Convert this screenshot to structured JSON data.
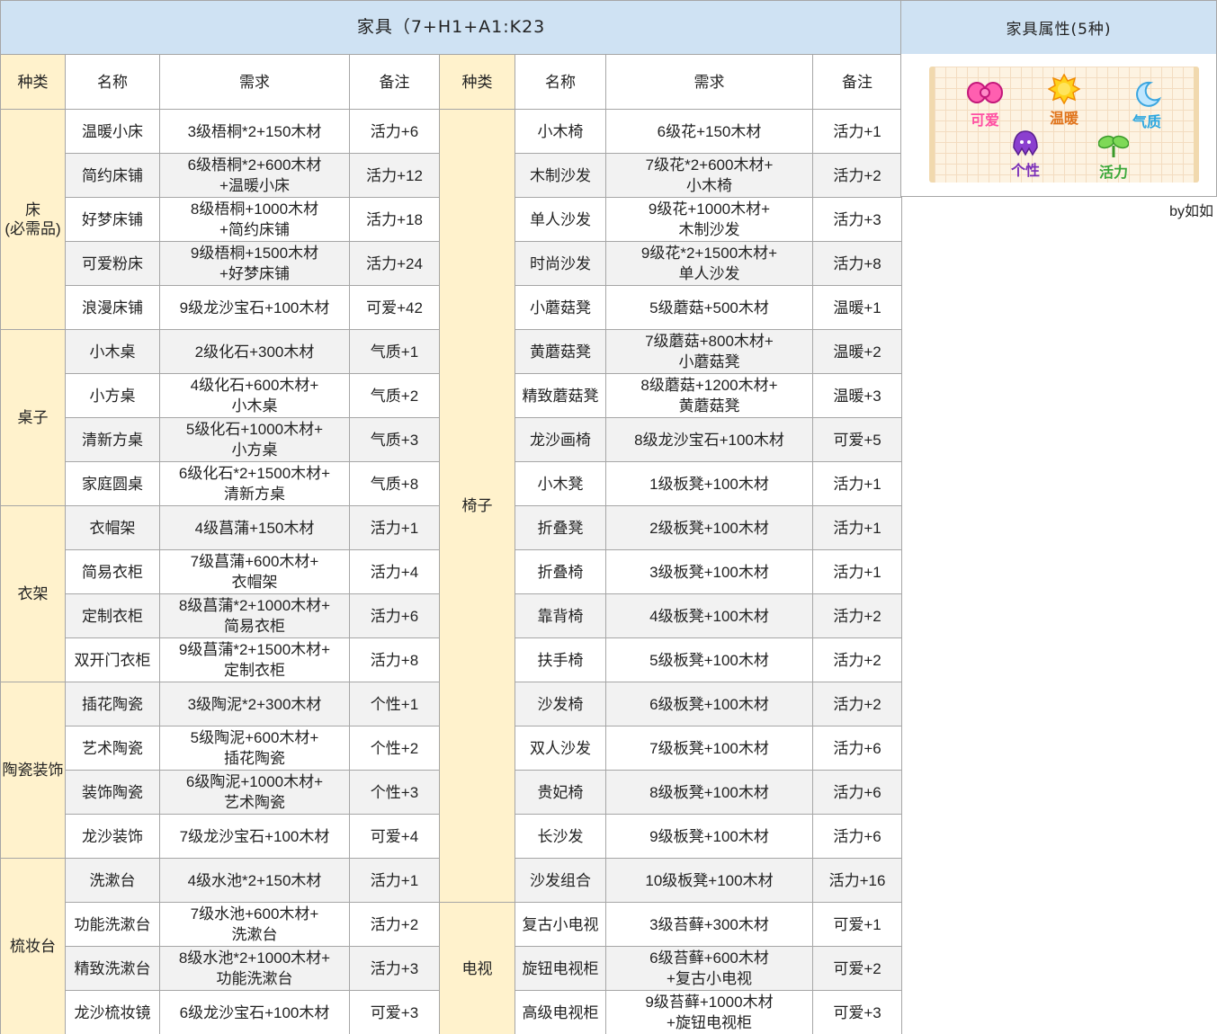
{
  "title": "家具（7+H1+A1:K23",
  "headers": {
    "left": [
      "种类",
      "名称",
      "需求",
      "备注"
    ],
    "right": [
      "种类",
      "名称",
      "需求",
      "备注"
    ]
  },
  "categories": {
    "bed": "床\n(必需品)",
    "table": "桌子",
    "hanger": "衣架",
    "ceramic": "陶瓷装饰",
    "dresser": "梳妆台",
    "chair": "椅子",
    "tv": "电视"
  },
  "rows": [
    {
      "l": [
        "温暖小床",
        "3级梧桐*2+150木材",
        "活力+6"
      ],
      "r": [
        "小木椅",
        "6级花+150木材",
        "活力+1"
      ]
    },
    {
      "l": [
        "简约床铺",
        "6级梧桐*2+600木材\n+温暖小床",
        "活力+12"
      ],
      "r": [
        "木制沙发",
        "7级花*2+600木材+\n小木椅",
        "活力+2"
      ]
    },
    {
      "l": [
        "好梦床铺",
        "8级梧桐+1000木材\n+简约床铺",
        "活力+18"
      ],
      "r": [
        "单人沙发",
        "9级花+1000木材+\n木制沙发",
        "活力+3"
      ]
    },
    {
      "l": [
        "可爱粉床",
        "9级梧桐+1500木材\n+好梦床铺",
        "活力+24"
      ],
      "r": [
        "时尚沙发",
        "9级花*2+1500木材+\n单人沙发",
        "活力+8"
      ]
    },
    {
      "l": [
        "浪漫床铺",
        "9级龙沙宝石+100木材",
        "可爱+42"
      ],
      "r": [
        "小蘑菇凳",
        "5级蘑菇+500木材",
        "温暖+1"
      ]
    },
    {
      "l": [
        "小木桌",
        "2级化石+300木材",
        "气质+1"
      ],
      "r": [
        "黄蘑菇凳",
        "7级蘑菇+800木材+\n小蘑菇凳",
        "温暖+2"
      ]
    },
    {
      "l": [
        "小方桌",
        "4级化石+600木材+\n小木桌",
        "气质+2"
      ],
      "r": [
        "精致蘑菇凳",
        "8级蘑菇+1200木材+\n黄蘑菇凳",
        "温暖+3"
      ]
    },
    {
      "l": [
        "清新方桌",
        "5级化石+1000木材+\n小方桌",
        "气质+3"
      ],
      "r": [
        "龙沙画椅",
        "8级龙沙宝石+100木材",
        "可爱+5"
      ]
    },
    {
      "l": [
        "家庭圆桌",
        "6级化石*2+1500木材+\n清新方桌",
        "气质+8"
      ],
      "r": [
        "小木凳",
        "1级板凳+100木材",
        "活力+1"
      ]
    },
    {
      "l": [
        "衣帽架",
        "4级菖蒲+150木材",
        "活力+1"
      ],
      "r": [
        "折叠凳",
        "2级板凳+100木材",
        "活力+1"
      ]
    },
    {
      "l": [
        "简易衣柜",
        "7级菖蒲+600木材+\n衣帽架",
        "活力+4"
      ],
      "r": [
        "折叠椅",
        "3级板凳+100木材",
        "活力+1"
      ]
    },
    {
      "l": [
        "定制衣柜",
        "8级菖蒲*2+1000木材+\n简易衣柜",
        "活力+6"
      ],
      "r": [
        "靠背椅",
        "4级板凳+100木材",
        "活力+2"
      ]
    },
    {
      "l": [
        "双开门衣柜",
        "9级菖蒲*2+1500木材+\n定制衣柜",
        "活力+8"
      ],
      "r": [
        "扶手椅",
        "5级板凳+100木材",
        "活力+2"
      ]
    },
    {
      "l": [
        "插花陶瓷",
        "3级陶泥*2+300木材",
        "个性+1"
      ],
      "r": [
        "沙发椅",
        "6级板凳+100木材",
        "活力+2"
      ]
    },
    {
      "l": [
        "艺术陶瓷",
        "5级陶泥+600木材+\n插花陶瓷",
        "个性+2"
      ],
      "r": [
        "双人沙发",
        "7级板凳+100木材",
        "活力+6"
      ]
    },
    {
      "l": [
        "装饰陶瓷",
        "6级陶泥+1000木材+\n艺术陶瓷",
        "个性+3"
      ],
      "r": [
        "贵妃椅",
        "8级板凳+100木材",
        "活力+6"
      ]
    },
    {
      "l": [
        "龙沙装饰",
        "7级龙沙宝石+100木材",
        "可爱+4"
      ],
      "r": [
        "长沙发",
        "9级板凳+100木材",
        "活力+6"
      ]
    },
    {
      "l": [
        "洗漱台",
        "4级水池*2+150木材",
        "活力+1"
      ],
      "r": [
        "沙发组合",
        "10级板凳+100木材",
        "活力+16"
      ]
    },
    {
      "l": [
        "功能洗漱台",
        "7级水池+600木材+\n洗漱台",
        "活力+2"
      ],
      "r": [
        "复古小电视",
        "3级苔藓+300木材",
        "可爱+1"
      ]
    },
    {
      "l": [
        "精致洗漱台",
        "8级水池*2+1000木材+\n功能洗漱台",
        "活力+3"
      ],
      "r": [
        "旋钮电视柜",
        "6级苔藓+600木材\n+复古小电视",
        "可爱+2"
      ]
    },
    {
      "l": [
        "龙沙梳妆镜",
        "6级龙沙宝石+100木材",
        "可爱+3"
      ],
      "r": [
        "高级电视柜",
        "9级苔藓+1000木材\n+旋钮电视柜",
        "可爱+3"
      ]
    }
  ],
  "attributes": {
    "title": "家具属性(5种)",
    "cute": "可爱",
    "warm": "温暖",
    "temperament": "气质",
    "individuality": "个性",
    "vitality": "活力"
  },
  "colors": {
    "vitality": "#70ad47",
    "cute": "#e633b8",
    "warm": "#f39c12",
    "temperament": "#1aa7d9",
    "individuality": "#7030a0"
  },
  "credit": "by如如"
}
